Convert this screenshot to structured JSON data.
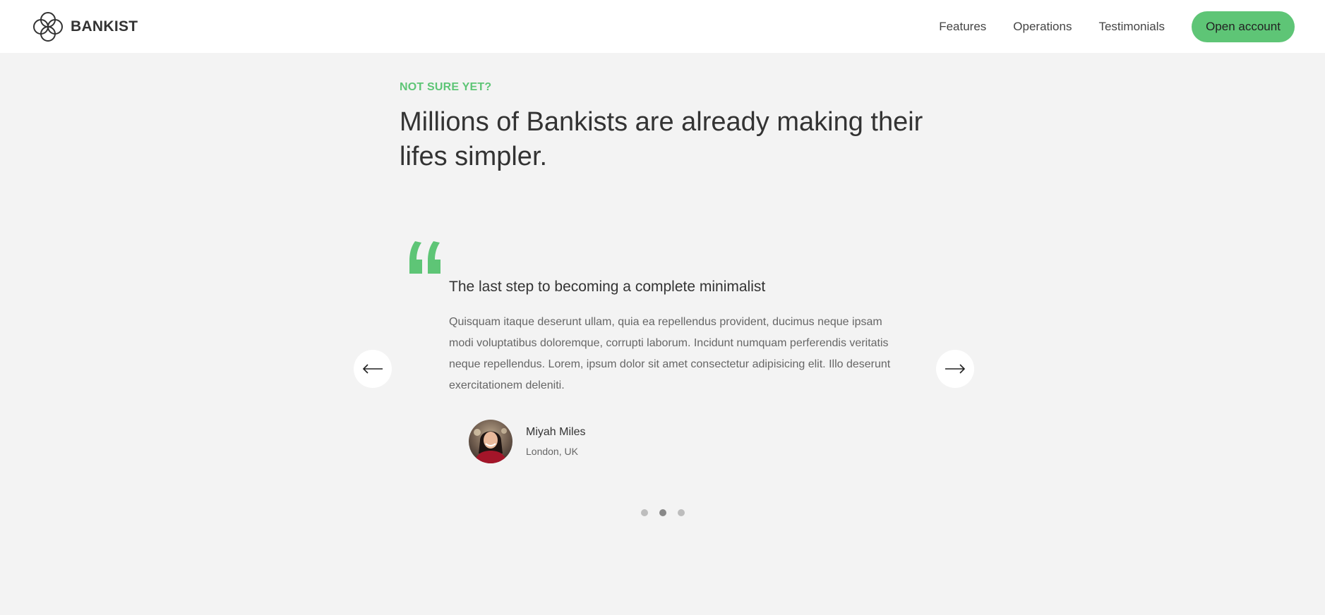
{
  "nav": {
    "brand": "BANKIST",
    "links": [
      "Features",
      "Operations",
      "Testimonials"
    ],
    "cta": "Open account"
  },
  "section": {
    "description": "NOT SURE YET?",
    "title": "Millions of Bankists are already making their lifes simpler."
  },
  "testimonial": {
    "header": "The last step to becoming a complete minimalist",
    "text": "Quisquam itaque deserunt ullam, quia ea repellendus provident, ducimus neque ipsam modi voluptatibus doloremque, corrupti laborum. Incidunt numquam perferendis veritatis neque repellendus. Lorem, ipsum dolor sit amet consectetur adipisicing elit. Illo deserunt exercitationem deleniti.",
    "author_name": "Miyah Miles",
    "author_location": "London, UK"
  },
  "slider": {
    "prev_icon": "arrow-left-icon",
    "next_icon": "arrow-right-icon",
    "dots": 3,
    "active_dot": 2
  },
  "colors": {
    "accent": "#5ec576",
    "background": "#f3f3f3",
    "nav_background": "#ffffff",
    "heading": "#333333",
    "body_text": "#666666"
  }
}
